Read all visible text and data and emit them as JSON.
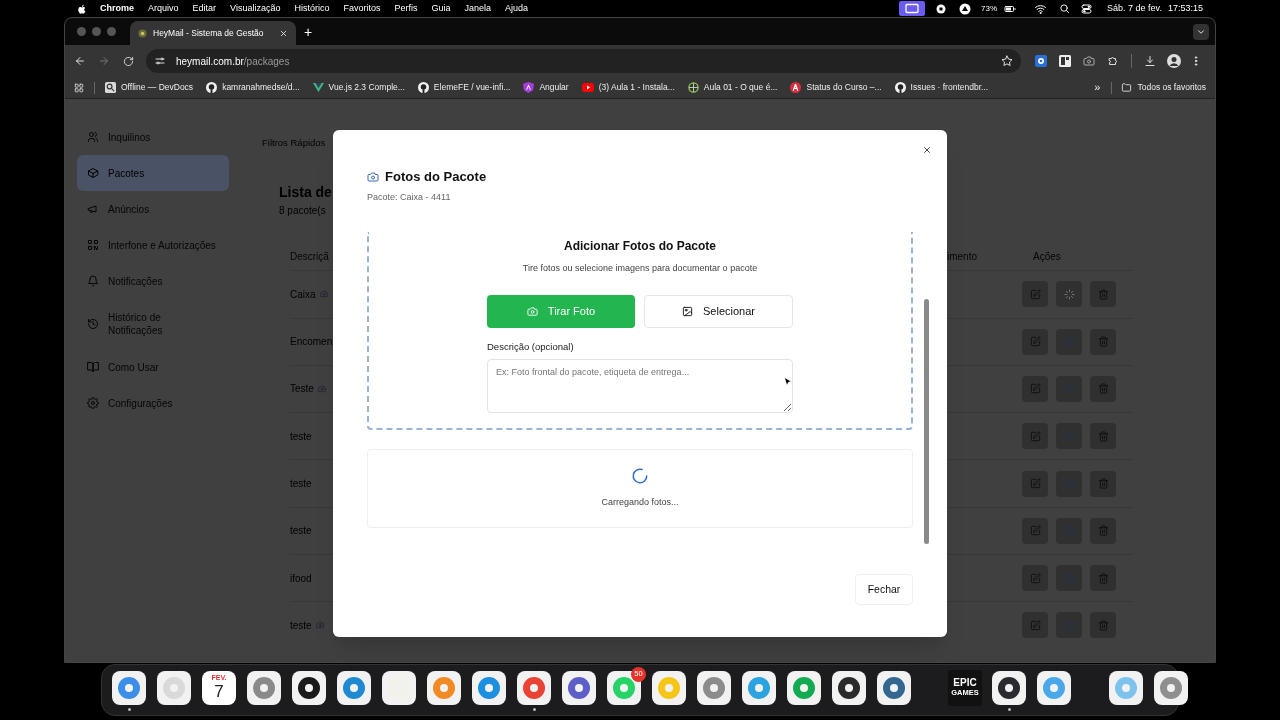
{
  "menu_bar": {
    "app": "Chrome",
    "menus": [
      "Arquivo",
      "Editar",
      "Visualização",
      "Histórico",
      "Favoritos",
      "Perfis",
      "Guia",
      "Janela",
      "Ajuda"
    ],
    "battery": "73%",
    "date": "Sáb. 7 de fev.",
    "time": "17:53:15"
  },
  "browser": {
    "tabs": [
      {
        "title": "HeyMail - Sistema de Gestão",
        "selected": true
      }
    ],
    "new_tab": "+",
    "url_host": "heymail.com.br",
    "url_path": "/packages",
    "bookmarks": [
      "Offline — DevDocs",
      "kamranahmedse/d...",
      "Vue.js 2.3 Comple...",
      "ElemeFE / vue-infi...",
      "Angular",
      "(3) Aula 1 - Instala...",
      "Aula 01 - O que é...",
      "Status do Curso –...",
      "Issues · frontendbr..."
    ],
    "more": "»",
    "all_bookmarks": "Todos os favoritos"
  },
  "sidebar": {
    "items": [
      {
        "label": "Inquilinos",
        "selected": false
      },
      {
        "label": "Pacotes",
        "selected": true
      },
      {
        "label": "Anúncios",
        "selected": false
      },
      {
        "label": "Interfone e Autorizações",
        "selected": false
      },
      {
        "label": "Notificações",
        "selected": false
      },
      {
        "label": "Histórico de Notificações",
        "selected": false
      },
      {
        "label": "Como Usar",
        "selected": false
      },
      {
        "label": "Configurações",
        "selected": false
      }
    ]
  },
  "page": {
    "quick_filters": "Filtros Rápidos",
    "title": "Lista de",
    "count": "8 pacote(s",
    "columns": [
      "Descriçã",
      "imento",
      "Ações"
    ],
    "rows": [
      {
        "description": "Caixa",
        "photo_icon": true,
        "loading": true
      },
      {
        "description": "Encomen",
        "photo_icon": false,
        "loading": false
      },
      {
        "description": "Teste",
        "photo_icon": true,
        "loading": false
      },
      {
        "description": "teste",
        "photo_icon": false,
        "loading": false
      },
      {
        "description": "teste",
        "photo_icon": false,
        "loading": false
      },
      {
        "description": "teste",
        "photo_icon": false,
        "loading": false
      },
      {
        "description": "ifood",
        "photo_icon": false,
        "loading": false
      },
      {
        "description": "teste",
        "photo_icon": true,
        "loading": false
      }
    ]
  },
  "modal": {
    "title": "Fotos do Pacote",
    "subtitle": "Pacote: Caixa - 4411",
    "upload_title": "Adicionar Fotos do Pacote",
    "upload_hint": "Tire fotos ou selecione imagens para documentar o pacote",
    "take_photo": "Tirar Foto",
    "select": "Selecionar",
    "description_label": "Descrição (opcional)",
    "description_placeholder": "Ex: Foto frontal do pacote, etiqueta de entrega...",
    "loading_text": "Carregando fotos...",
    "close_button": "Fechar"
  },
  "dock": {
    "apps": [
      {
        "kind": "tile",
        "color": "#3b8fe8",
        "running": true
      },
      {
        "kind": "tile",
        "color": "#d9d9d9",
        "running": false
      },
      {
        "kind": "calendar",
        "month": "FEV.",
        "day": "7",
        "running": false
      },
      {
        "kind": "tile",
        "color": "#8a8a8a",
        "running": false
      },
      {
        "kind": "tile",
        "color": "#1a1a1a",
        "running": false
      },
      {
        "kind": "tile",
        "color": "#1f8ad2",
        "running": false
      },
      {
        "kind": "tile",
        "color": "#f4f1ea",
        "running": false
      },
      {
        "kind": "tile",
        "color": "#f08a24",
        "running": false
      },
      {
        "kind": "tile",
        "color": "#1d8fe1",
        "running": false
      },
      {
        "kind": "tile",
        "color": "#ea4335",
        "running": true
      },
      {
        "kind": "tile",
        "color": "#5b5fc7",
        "running": false
      },
      {
        "kind": "tile",
        "color": "#25d366",
        "badge": "50",
        "running": false
      },
      {
        "kind": "tile",
        "color": "#f5c518",
        "running": false
      },
      {
        "kind": "tile",
        "color": "#8c8c8c",
        "running": false
      },
      {
        "kind": "tile",
        "color": "#2aa3e0",
        "running": false
      },
      {
        "kind": "tile",
        "color": "#13aa52",
        "running": false
      },
      {
        "kind": "tile",
        "color": "#2b2b2b",
        "running": false
      },
      {
        "kind": "tile",
        "color": "#336791",
        "running": false
      },
      {
        "kind": "separator"
      },
      {
        "kind": "wordmark",
        "lines": [
          "EPIC",
          "GAMES"
        ],
        "running": false
      },
      {
        "kind": "tile",
        "color": "#2a2a30",
        "running": true
      },
      {
        "kind": "tile",
        "color": "#4aa8e8",
        "running": false
      },
      {
        "kind": "separator"
      },
      {
        "kind": "tile",
        "color": "#7dc3ee",
        "running": false
      },
      {
        "kind": "tile",
        "color": "#8f8f8f",
        "running": false
      }
    ]
  }
}
